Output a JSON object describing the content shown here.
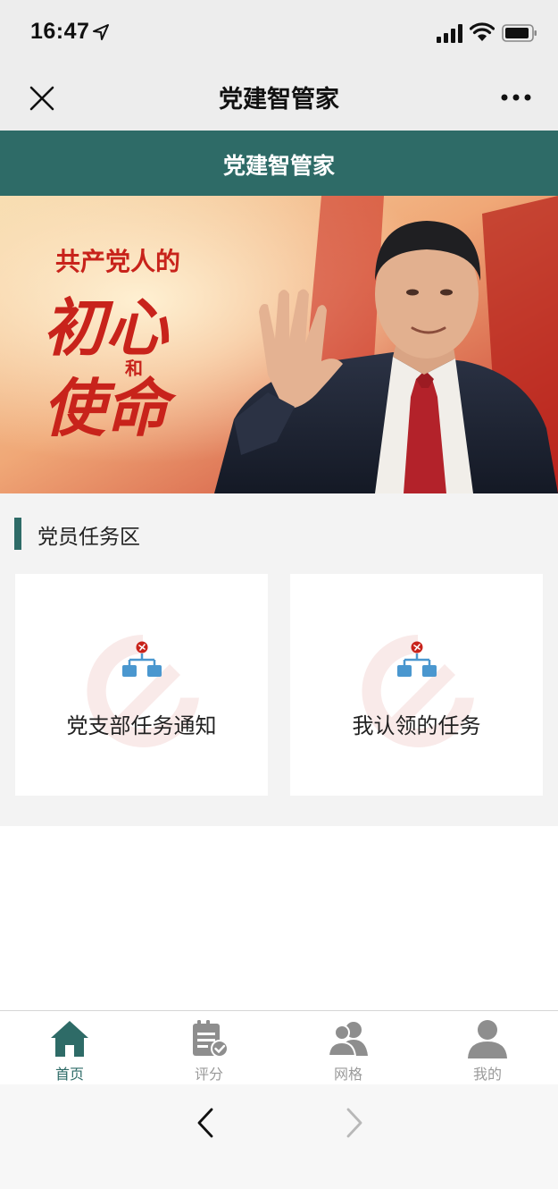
{
  "status_bar": {
    "time": "16:47"
  },
  "wechat_nav": {
    "title": "党建智管家"
  },
  "app_header": {
    "title": "党建智管家"
  },
  "banner": {
    "line1": "共产党人的",
    "line2": "初心",
    "line3": "和",
    "line4": "使命"
  },
  "task_section": {
    "title": "党员任务区",
    "cards": [
      {
        "label": "党支部任务通知"
      },
      {
        "label": "我认领的任务"
      }
    ]
  },
  "tabbar": {
    "active_color": "#2e6b67",
    "inactive_color": "#9a9a9a",
    "items": [
      {
        "label": "首页",
        "icon": "home-icon",
        "active": true
      },
      {
        "label": "评分",
        "icon": "clipboard-check-icon",
        "active": false
      },
      {
        "label": "网格",
        "icon": "users-icon",
        "active": false
      },
      {
        "label": "我的",
        "icon": "user-icon",
        "active": false
      }
    ]
  },
  "colors": {
    "theme": "#2e6b67",
    "banner_red": "#c8231b"
  }
}
